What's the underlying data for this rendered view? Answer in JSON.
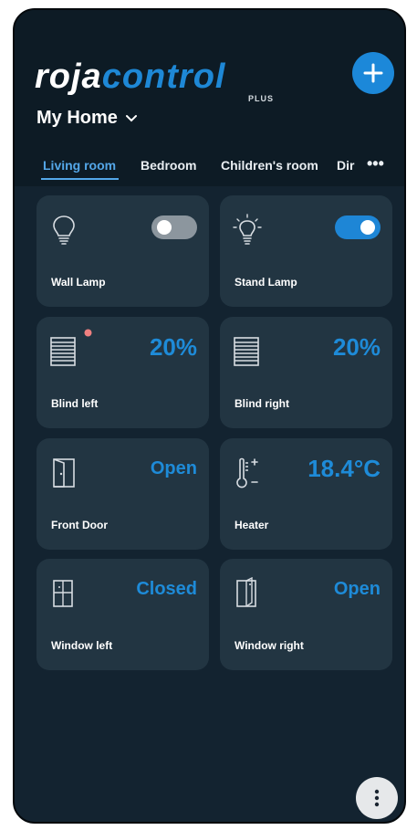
{
  "app": {
    "logo_primary": "roja",
    "logo_secondary": "control",
    "logo_suffix": "PLUS",
    "home_name": "My Home"
  },
  "tabs": [
    {
      "label": "Living room",
      "active": true
    },
    {
      "label": "Bedroom"
    },
    {
      "label": "Children's room"
    },
    {
      "label": "Dir"
    }
  ],
  "more_tabs": "•••",
  "devices": [
    {
      "name": "Wall Lamp",
      "type": "lamp",
      "state": "off",
      "icon": "lightbulb-icon"
    },
    {
      "name": "Stand Lamp",
      "type": "lamp",
      "state": "on",
      "icon": "lightbulb-on-icon"
    },
    {
      "name": "Blind left",
      "type": "blind",
      "value": "20%",
      "icon": "blinds-icon"
    },
    {
      "name": "Blind right",
      "type": "blind",
      "value": "20%",
      "icon": "blinds-icon"
    },
    {
      "name": "Front Door",
      "type": "door",
      "value": "Open",
      "icon": "door-icon"
    },
    {
      "name": "Heater",
      "type": "heater",
      "value": "18.4°C",
      "icon": "thermometer-icon"
    },
    {
      "name": "Window left",
      "type": "window",
      "value": "Closed",
      "icon": "window-icon"
    },
    {
      "name": "Window right",
      "type": "window",
      "value": "Open",
      "icon": "window-open-icon"
    }
  ],
  "colors": {
    "background": "#132330",
    "card": "#223542",
    "accent": "#1e88d6",
    "text": "#ffffff",
    "indicator": "#f08080"
  }
}
